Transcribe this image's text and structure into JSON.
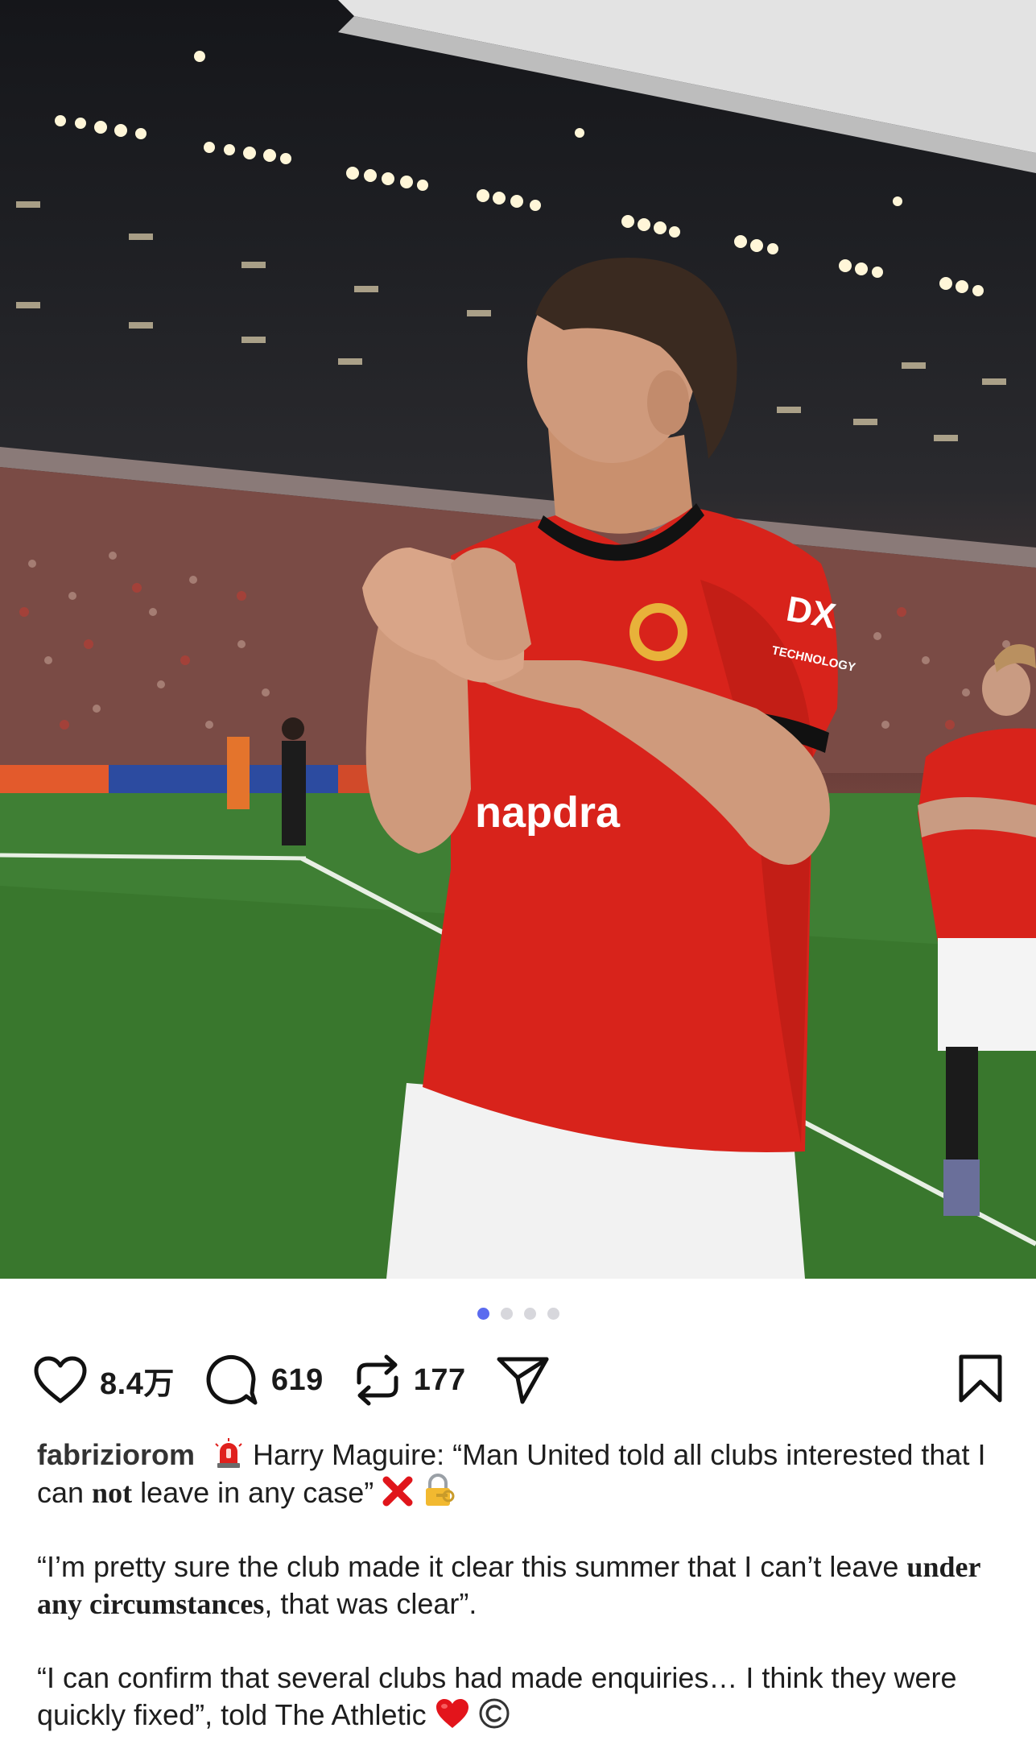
{
  "post": {
    "carousel": {
      "count": 4,
      "active_index": 0
    },
    "actions": {
      "likes": "8.4万",
      "comments": "619",
      "reposts": "177"
    },
    "caption": {
      "username": "fabriziorom",
      "line1_a": "Harry Maguire: “Man United told all clubs interested that I can ",
      "line1_b": "not",
      "line1_c": " leave in any case”",
      "para2_a": "“I’m pretty sure the club made it clear this summer that I can’t leave ",
      "para2_b": "under any circumstances",
      "para2_c": ", that was clear”.",
      "para3": "“I can confirm that several clubs had made enquiries… I think they were quickly fixed”, told The Athletic"
    },
    "photo_text": {
      "sponsor": "napdra",
      "sleeve": "TECHNOLOGY"
    },
    "icons": [
      "heart-icon",
      "comment-icon",
      "repost-icon",
      "share-icon",
      "bookmark-icon",
      "siren-emoji",
      "cross-emoji",
      "lock-key-emoji",
      "heart-emoji",
      "copyright-emoji"
    ],
    "colors": {
      "accent_dot": "#5b6bef",
      "jersey_red": "#d8231b",
      "cross_red": "#e0151b"
    }
  }
}
